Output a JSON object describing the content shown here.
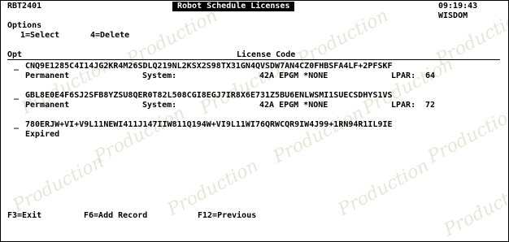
{
  "header": {
    "system_name": "RBT2401",
    "title": "Robot Schedule Licenses",
    "time": "09:19:43",
    "user": "WISDOM"
  },
  "options": {
    "heading": "Options",
    "items": [
      "1=Select",
      "4=Delete"
    ]
  },
  "columns": {
    "opt": "Opt",
    "license_code": "License Code"
  },
  "records": [
    {
      "opt": "_",
      "code": "CNQ9E1285C4I14JG2KR4M26SDLQ219NL2KSX2S98TX31GN4QVSDW7AN4CZ0FHBSFA4LF+2PFSKF",
      "type": "Permanent",
      "system_label": "System:",
      "system_value": "42A EPGM *NONE",
      "lpar_label": "LPAR:",
      "lpar_value": "64"
    },
    {
      "opt": "_",
      "code": "GBL8E0E4F6SJ2SFB8YZSU8QER0T82L508CGI8EGJ7IR8X6E731Z5BU6ENLWSMI1SUECSDHYS1VS",
      "type": "Permanent",
      "system_label": "System:",
      "system_value": "42A EPGM *NONE",
      "lpar_label": "LPAR:",
      "lpar_value": "72"
    },
    {
      "opt": "_",
      "code": "780ERJW+VI+V9L11NEWI411J147IIW811Q194W+VI9L11WI76QRWCQR9IW4J99+1RN94R1IL9IE",
      "type": "Expired"
    }
  ],
  "function_keys": [
    "F3=Exit",
    "F6=Add Record",
    "F12=Previous"
  ],
  "watermark": "Production"
}
